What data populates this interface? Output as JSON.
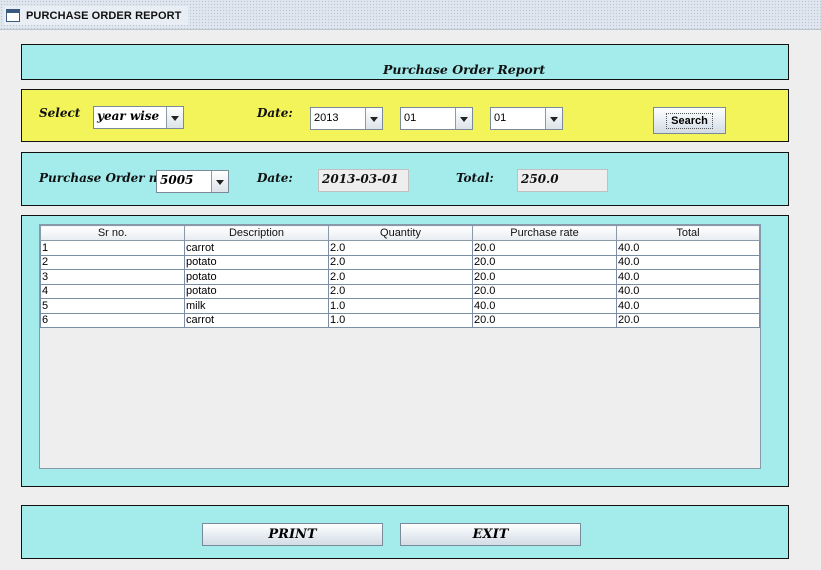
{
  "window": {
    "title": "PURCHASE ORDER REPORT",
    "icon": "window-icon"
  },
  "header": {
    "title": "Purchase Order Report"
  },
  "filters": {
    "select_label": "Select",
    "select_value": "year wise",
    "date_label": "Date:",
    "year": "2013",
    "month": "01",
    "day": "01",
    "search_label": "Search"
  },
  "order_info": {
    "po_label": "Purchase Order no:",
    "po_value": "5005",
    "date_label": "Date:",
    "date_value": "2013-03-01",
    "total_label": "Total:",
    "total_value": "250.0"
  },
  "table": {
    "columns": [
      "Sr no.",
      "Description",
      "Quantity",
      "Purchase rate",
      "Total"
    ],
    "rows": [
      [
        "1",
        "carrot",
        "2.0",
        "20.0",
        "40.0"
      ],
      [
        "2",
        "potato",
        "2.0",
        "20.0",
        "40.0"
      ],
      [
        "3",
        "potato",
        "2.0",
        "20.0",
        "40.0"
      ],
      [
        "4",
        "potato",
        "2.0",
        "20.0",
        "40.0"
      ],
      [
        "5",
        "milk",
        "1.0",
        "40.0",
        "40.0"
      ],
      [
        "6",
        "carrot",
        "1.0",
        "20.0",
        "20.0"
      ]
    ]
  },
  "actions": {
    "print_label": "PRINT",
    "exit_label": "EXIT"
  },
  "colors": {
    "panel_cyan": "#a4ebec",
    "panel_yellow": "#f3f35a",
    "background": "#eeeeee"
  }
}
